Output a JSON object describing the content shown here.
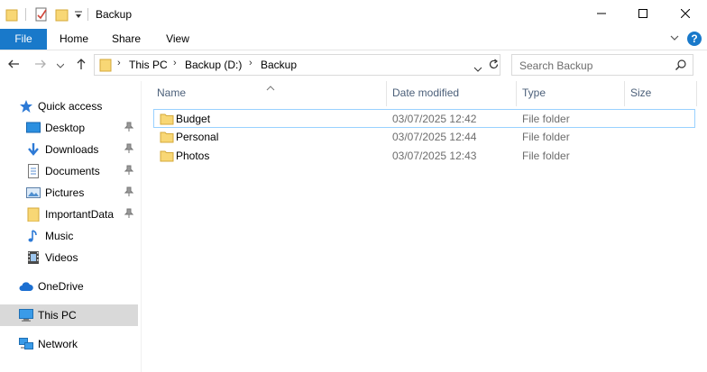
{
  "window": {
    "title": "Backup",
    "minimize_icon": "minimize-icon",
    "maximize_icon": "maximize-icon",
    "close_icon": "close-icon"
  },
  "quick_access_toolbar": [
    "folder-icon",
    "properties-icon",
    "new-folder-icon",
    "customize-dropdown-icon"
  ],
  "ribbon": {
    "tabs": [
      {
        "label": "File"
      },
      {
        "label": "Home"
      },
      {
        "label": "Share"
      },
      {
        "label": "View"
      }
    ],
    "help_label": "?"
  },
  "navigation": {
    "back_icon": "back-arrow-icon",
    "forward_icon": "forward-arrow-icon",
    "recent_icon": "recent-locations-chevron-icon",
    "up_icon": "up-arrow-icon",
    "breadcrumb": [
      "This PC",
      "Backup (D:)",
      "Backup"
    ],
    "search_placeholder": "Search Backup"
  },
  "sidebar": {
    "items": [
      {
        "label": "Quick access",
        "icon": "star-icon",
        "pinned": false
      },
      {
        "label": "Desktop",
        "icon": "desktop-icon",
        "pinned": true
      },
      {
        "label": "Downloads",
        "icon": "downloads-icon",
        "pinned": true
      },
      {
        "label": "Documents",
        "icon": "documents-icon",
        "pinned": true
      },
      {
        "label": "Pictures",
        "icon": "pictures-icon",
        "pinned": true
      },
      {
        "label": "ImportantData",
        "icon": "folder-icon",
        "pinned": true
      },
      {
        "label": "Music",
        "icon": "music-icon",
        "pinned": false
      },
      {
        "label": "Videos",
        "icon": "videos-icon",
        "pinned": false
      },
      {
        "label": "OneDrive",
        "icon": "cloud-icon",
        "pinned": false
      },
      {
        "label": "This PC",
        "icon": "computer-icon",
        "pinned": false,
        "selected": true
      },
      {
        "label": "Network",
        "icon": "network-icon",
        "pinned": false
      }
    ]
  },
  "file_list": {
    "columns": [
      "Name",
      "Date modified",
      "Type",
      "Size"
    ],
    "rows": [
      {
        "name": "Budget",
        "date_modified": "03/07/2025 12:42",
        "type": "File folder",
        "size": ""
      },
      {
        "name": "Personal",
        "date_modified": "03/07/2025 12:44",
        "type": "File folder",
        "size": ""
      },
      {
        "name": "Photos",
        "date_modified": "03/07/2025 12:43",
        "type": "File folder",
        "size": ""
      }
    ]
  },
  "colors": {
    "accent": "#1979ca",
    "folder": "#f8d775",
    "selection": "#d9d9d9",
    "column_header_text": "#4c607a"
  }
}
